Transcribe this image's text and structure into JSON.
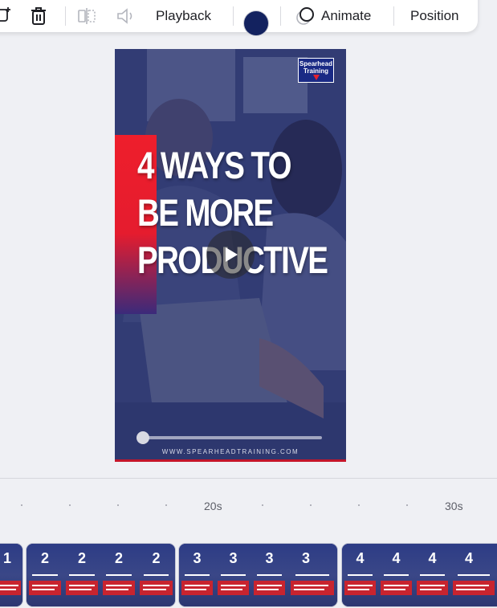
{
  "toolbar": {
    "playback_label": "Playback",
    "animate_label": "Animate",
    "position_label": "Position",
    "current_color": "#13225f"
  },
  "video": {
    "headline_lines": [
      "4 WAYS TO",
      "BE MORE",
      "PRODUCTIVE"
    ],
    "logo_text": [
      "Spearhead",
      "Training"
    ],
    "website": "WWW.SPEARHEADTRAINING.COM",
    "progress": 0.0
  },
  "timeline": {
    "ticks": [
      "20s",
      "30s"
    ],
    "clips": [
      {
        "number": "1",
        "thumb_count": 1
      },
      {
        "number": "2",
        "thumb_count": 4
      },
      {
        "number": "3",
        "thumb_count": 4
      },
      {
        "number": "4",
        "thumb_count": 4
      }
    ]
  }
}
